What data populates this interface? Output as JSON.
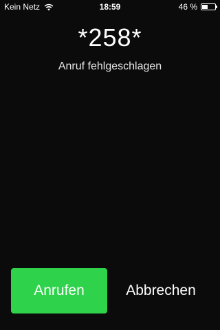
{
  "status_bar": {
    "carrier": "Kein Netz",
    "time": "18:59",
    "battery_text": "46 %",
    "battery_level": 0.46,
    "wifi_icon": "wifi-icon",
    "battery_icon": "battery-icon"
  },
  "call": {
    "number": "*258*",
    "status": "Anruf fehlgeschlagen"
  },
  "actions": {
    "call_label": "Anrufen",
    "cancel_label": "Abbrechen"
  },
  "colors": {
    "background": "#0b0b0b",
    "call_button": "#2ed34b"
  }
}
